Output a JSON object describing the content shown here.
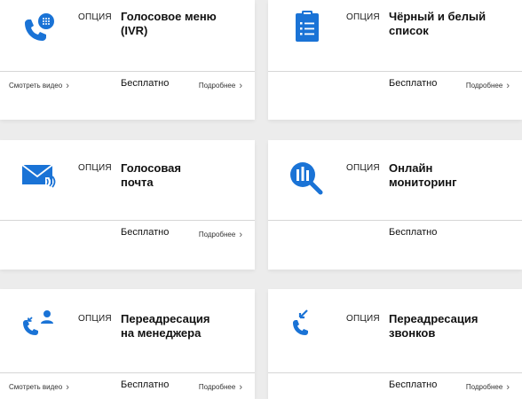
{
  "colors": {
    "accent": "#1a73d6",
    "card_bg": "#ffffff",
    "page_bg": "#ececec"
  },
  "cards": [
    {
      "tag": "ОПЦИЯ",
      "title_line1": "Голосовое меню",
      "title_line2": "(IVR)",
      "price": "Бесплатно",
      "video_link": "Смотреть видео",
      "more_link": "Подробнее",
      "icon": "phone-keypad-icon"
    },
    {
      "tag": "ОПЦИЯ",
      "title_line1": "Чёрный и белый",
      "title_line2": "список",
      "price": "Бесплатно",
      "video_link": "",
      "more_link": "Подробнее",
      "icon": "clipboard-list-icon"
    },
    {
      "tag": "ОПЦИЯ",
      "title_line1": "Голосовая",
      "title_line2": "почта",
      "price": "Бесплатно",
      "video_link": "",
      "more_link": "Подробнее",
      "icon": "voicemail-envelope-icon"
    },
    {
      "tag": "ОПЦИЯ",
      "title_line1": "Онлайн",
      "title_line2": "мониторинг",
      "price": "Бесплатно",
      "video_link": "",
      "more_link": "",
      "icon": "monitoring-search-icon"
    },
    {
      "tag": "ОПЦИЯ",
      "title_line1": "Переадресация",
      "title_line2": "на менеджера",
      "price": "Бесплатно",
      "video_link": "Смотреть видео",
      "more_link": "Подробнее",
      "icon": "phone-forward-manager-icon"
    },
    {
      "tag": "ОПЦИЯ",
      "title_line1": "Переадресация",
      "title_line2": "звонков",
      "price": "Бесплатно",
      "video_link": "",
      "more_link": "Подробнее",
      "icon": "phone-forward-icon"
    }
  ]
}
